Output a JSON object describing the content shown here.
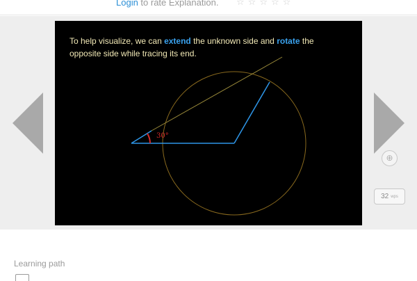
{
  "rating": {
    "login_label": "Login",
    "rest_text": " to rate Explanation.",
    "stars": [
      "☆",
      "☆",
      "☆",
      "☆",
      "☆"
    ]
  },
  "player": {
    "caption": {
      "part1": "To help visualize, we can ",
      "extend": "extend",
      "part2": " the unknown side and ",
      "rotate": "rotate",
      "part3": " the opposite side while tracing its end."
    },
    "angle_label": "30°",
    "colors": {
      "background": "#000000",
      "segment": "#2e96e8",
      "circle": "#8a6a1e",
      "extension": "#9a8a3a",
      "angle": "#d42a2a",
      "caption": "#f2e9b6"
    }
  },
  "controls": {
    "share_icon": "⊕",
    "speed_value": "32",
    "speed_unit": "wps"
  },
  "learning_path": {
    "label": "Learning path"
  }
}
